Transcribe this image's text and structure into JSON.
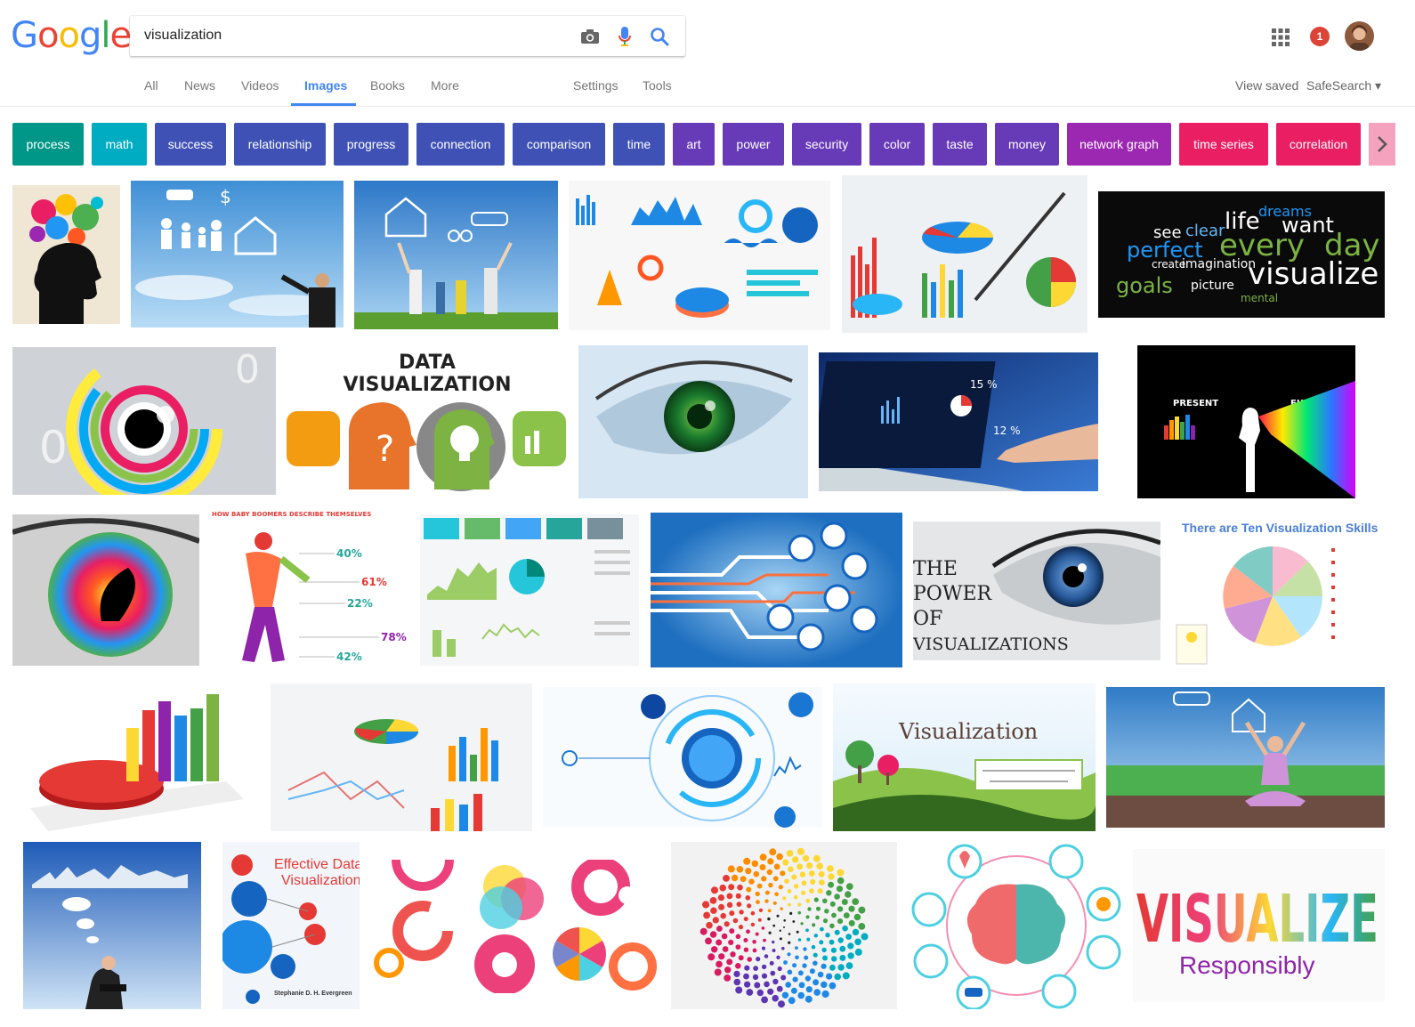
{
  "logo": {
    "letters": [
      "G",
      "o",
      "o",
      "g",
      "l",
      "e"
    ],
    "colors": [
      "#4285f4",
      "#ea4335",
      "#fbbc05",
      "#4285f4",
      "#34a853",
      "#ea4335"
    ]
  },
  "search": {
    "query": "visualization"
  },
  "tabs": [
    "All",
    "News",
    "Videos",
    "Images",
    "Books",
    "More"
  ],
  "active_tab": "Images",
  "tools": {
    "settings": "Settings",
    "tools": "Tools"
  },
  "right": {
    "view_saved": "View saved",
    "safesearch": "SafeSearch ▾",
    "notifications": "1"
  },
  "chips": [
    {
      "label": "process",
      "color": "#009688"
    },
    {
      "label": "math",
      "color": "#00acc1"
    },
    {
      "label": "success",
      "color": "#3f51b5"
    },
    {
      "label": "relationship",
      "color": "#3f51b5"
    },
    {
      "label": "progress",
      "color": "#3f51b5"
    },
    {
      "label": "connection",
      "color": "#3f51b5"
    },
    {
      "label": "comparison",
      "color": "#3f51b5"
    },
    {
      "label": "time",
      "color": "#3f51b5"
    },
    {
      "label": "art",
      "color": "#673ab7"
    },
    {
      "label": "power",
      "color": "#673ab7"
    },
    {
      "label": "security",
      "color": "#673ab7"
    },
    {
      "label": "color",
      "color": "#673ab7"
    },
    {
      "label": "taste",
      "color": "#673ab7"
    },
    {
      "label": "money",
      "color": "#673ab7"
    },
    {
      "label": "network graph",
      "color": "#9c27b0"
    },
    {
      "label": "time series",
      "color": "#e91e63"
    },
    {
      "label": "correlation",
      "color": "#e91e63"
    }
  ],
  "thumb_text": {
    "data_vis_title_1": "DATA",
    "data_vis_title_2": "VISUALIZATION",
    "present": "PRESENT",
    "future": "FUTURE",
    "boomers": "HOW BABY BOOMERS DESCRIBE THEMSELVES",
    "boomer_pcts": [
      "40%",
      "61%",
      "22%",
      "78%",
      "42%"
    ],
    "power_1": "THE",
    "power_2": "POWER",
    "power_3": "OF",
    "power_4": "VISUALIZATIONS",
    "ten_skills": "There are Ten Visualization Skills",
    "vis_title": "Visualization",
    "effective_1": "Effective Data",
    "effective_2": "Visualization",
    "effective_author": "Stephanie D. H. Evergreen",
    "visualize_word": "VISUALIZE",
    "responsibly": "Responsibly",
    "cloud_words": [
      "dreams",
      "life",
      "want",
      "see",
      "clear",
      "every",
      "day",
      "perfect",
      "visualize",
      "goals",
      "create",
      "imagination",
      "picture",
      "mental"
    ]
  }
}
